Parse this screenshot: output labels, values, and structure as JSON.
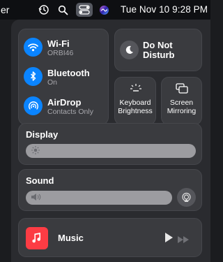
{
  "menubar": {
    "partial_text": "er",
    "clock": "Tue Nov 10  9:28 PM",
    "icons": [
      "time-machine-icon",
      "search-icon",
      "control-center-icon",
      "siri-icon"
    ]
  },
  "connectivity": {
    "wifi": {
      "label": "Wi-Fi",
      "status": "ORBI46"
    },
    "bluetooth": {
      "label": "Bluetooth",
      "status": "On"
    },
    "airdrop": {
      "label": "AirDrop",
      "status": "Contacts Only"
    }
  },
  "do_not_disturb": {
    "line1": "Do Not",
    "line2": "Disturb"
  },
  "keyboard_brightness": {
    "line1": "Keyboard",
    "line2": "Brightness"
  },
  "screen_mirroring": {
    "line1": "Screen",
    "line2": "Mirroring"
  },
  "display": {
    "label": "Display",
    "level": 0.0
  },
  "sound": {
    "label": "Sound",
    "level": 0.0
  },
  "music": {
    "label": "Music"
  },
  "colors": {
    "accent": "#0a84ff",
    "tile": "#3a3b3f",
    "panel": "#2a2b2f",
    "music_icon": "#fc3c44"
  }
}
